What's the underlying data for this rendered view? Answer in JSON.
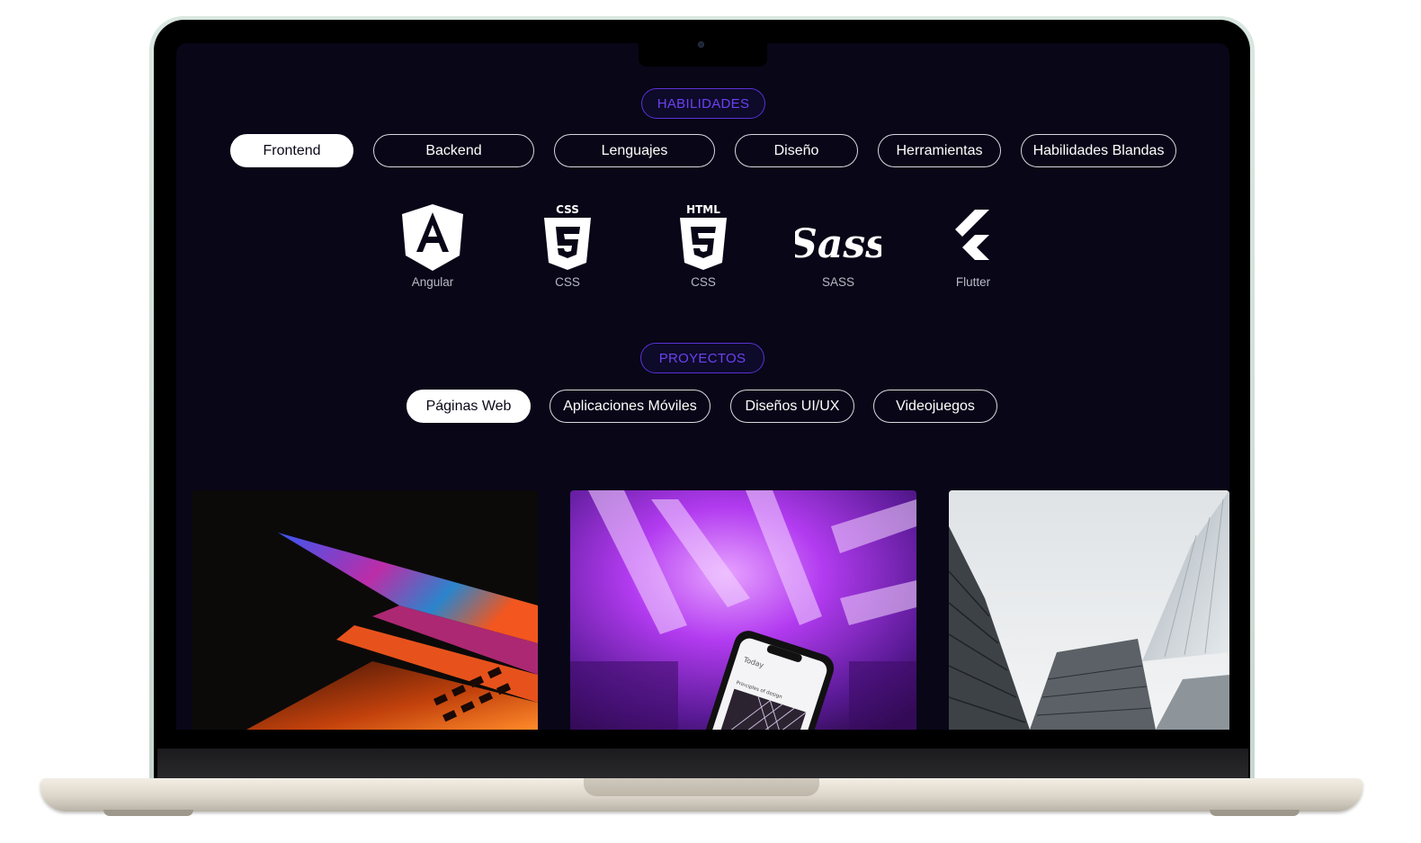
{
  "skills_section": {
    "title": "HABILIDADES",
    "tabs": [
      {
        "label": "Frontend",
        "active": true
      },
      {
        "label": "Backend",
        "active": false
      },
      {
        "label": "Lenguajes",
        "active": false
      },
      {
        "label": "Diseño",
        "active": false
      },
      {
        "label": "Herramientas",
        "active": false
      },
      {
        "label": "Habilidades Blandas",
        "active": false
      }
    ],
    "items": [
      {
        "label": "Angular",
        "icon": "angular-icon",
        "badge": ""
      },
      {
        "label": "CSS",
        "icon": "css3-icon",
        "badge": "CSS"
      },
      {
        "label": "CSS",
        "icon": "html5-icon",
        "badge": "HTML"
      },
      {
        "label": "SASS",
        "icon": "sass-icon",
        "badge": ""
      },
      {
        "label": "Flutter",
        "icon": "flutter-icon",
        "badge": ""
      }
    ]
  },
  "projects_section": {
    "title": "PROYECTOS",
    "tabs": [
      {
        "label": "Páginas Web",
        "active": true
      },
      {
        "label": "Aplicaciones Móviles",
        "active": false
      },
      {
        "label": "Diseños UI/UX",
        "active": false
      },
      {
        "label": "Videojuegos",
        "active": false
      }
    ],
    "cards": [
      {
        "image": "laptop-photo"
      },
      {
        "image": "phone-neon-photo",
        "phone_title": "Today",
        "phone_caption": "Principles of design"
      },
      {
        "image": "skyscrapers-photo"
      }
    ]
  },
  "colors": {
    "page_background": "#080617",
    "accent": "#5a31d6",
    "accent_text": "#6b42f0",
    "active_tab_bg": "#ffffff"
  }
}
